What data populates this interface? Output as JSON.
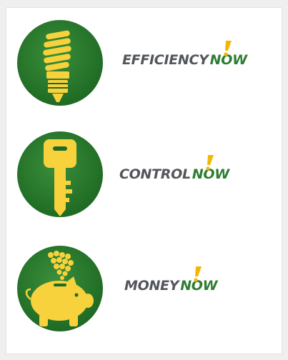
{
  "items": [
    {
      "word": "EFFICIENCY",
      "suffix": "NOW",
      "icon": "light-bulb-icon"
    },
    {
      "word": "CONTROL",
      "suffix": "NOW",
      "icon": "key-icon"
    },
    {
      "word": "MONEY",
      "suffix": "NOW",
      "icon": "piggy-bank-icon"
    }
  ],
  "colors": {
    "green": "#2e7d32",
    "green_dark": "#1f5e22",
    "yellow": "#f7d23c",
    "gray_text": "#53565a"
  }
}
